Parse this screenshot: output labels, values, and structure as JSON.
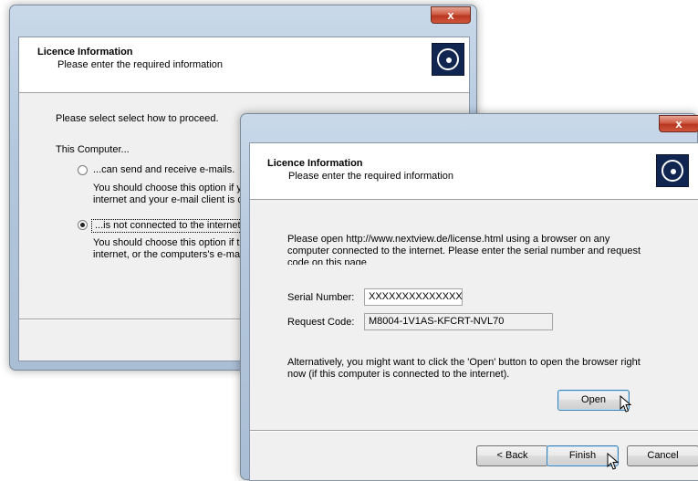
{
  "back_window": {
    "close_label": "x",
    "header_title": "Licence Information",
    "header_subtitle": "Please enter the required information",
    "prompt": "Please select select how to proceed.",
    "group_label": "This Computer...",
    "option1": {
      "label": "...can send and receive e-mails.",
      "desc_line1": "You should choose this option if yo",
      "desc_line2": "internet and your e-mail client is co"
    },
    "option2": {
      "label": "...is not connected to the internet.",
      "desc_line1": "You should choose this option if th",
      "desc_line2": "internet, or the computers's e-mail"
    }
  },
  "front_window": {
    "close_label": "x",
    "header_title": "Licence Information",
    "header_subtitle": "Please enter the required information",
    "instructions_line1": "Please open http://www.nextview.de/license.html using a browser on any",
    "instructions_line2": "computer connected to the internet. Please enter the serial number and request",
    "instructions_line3": "code on this page",
    "serial_label": "Serial Number:",
    "serial_value": "XXXXXXXXXXXXXXX",
    "request_label": "Request Code:",
    "request_value": "M8004-1V1AS-KFCRT-NVL70",
    "alt_line1": "Alternatively, you might want to click the 'Open' button to open the browser right",
    "alt_line2": "now (if this computer is connected to the internet).",
    "open_button": "Open",
    "back_button": "< Back",
    "finish_button": "Finish",
    "cancel_button": "Cancel"
  }
}
